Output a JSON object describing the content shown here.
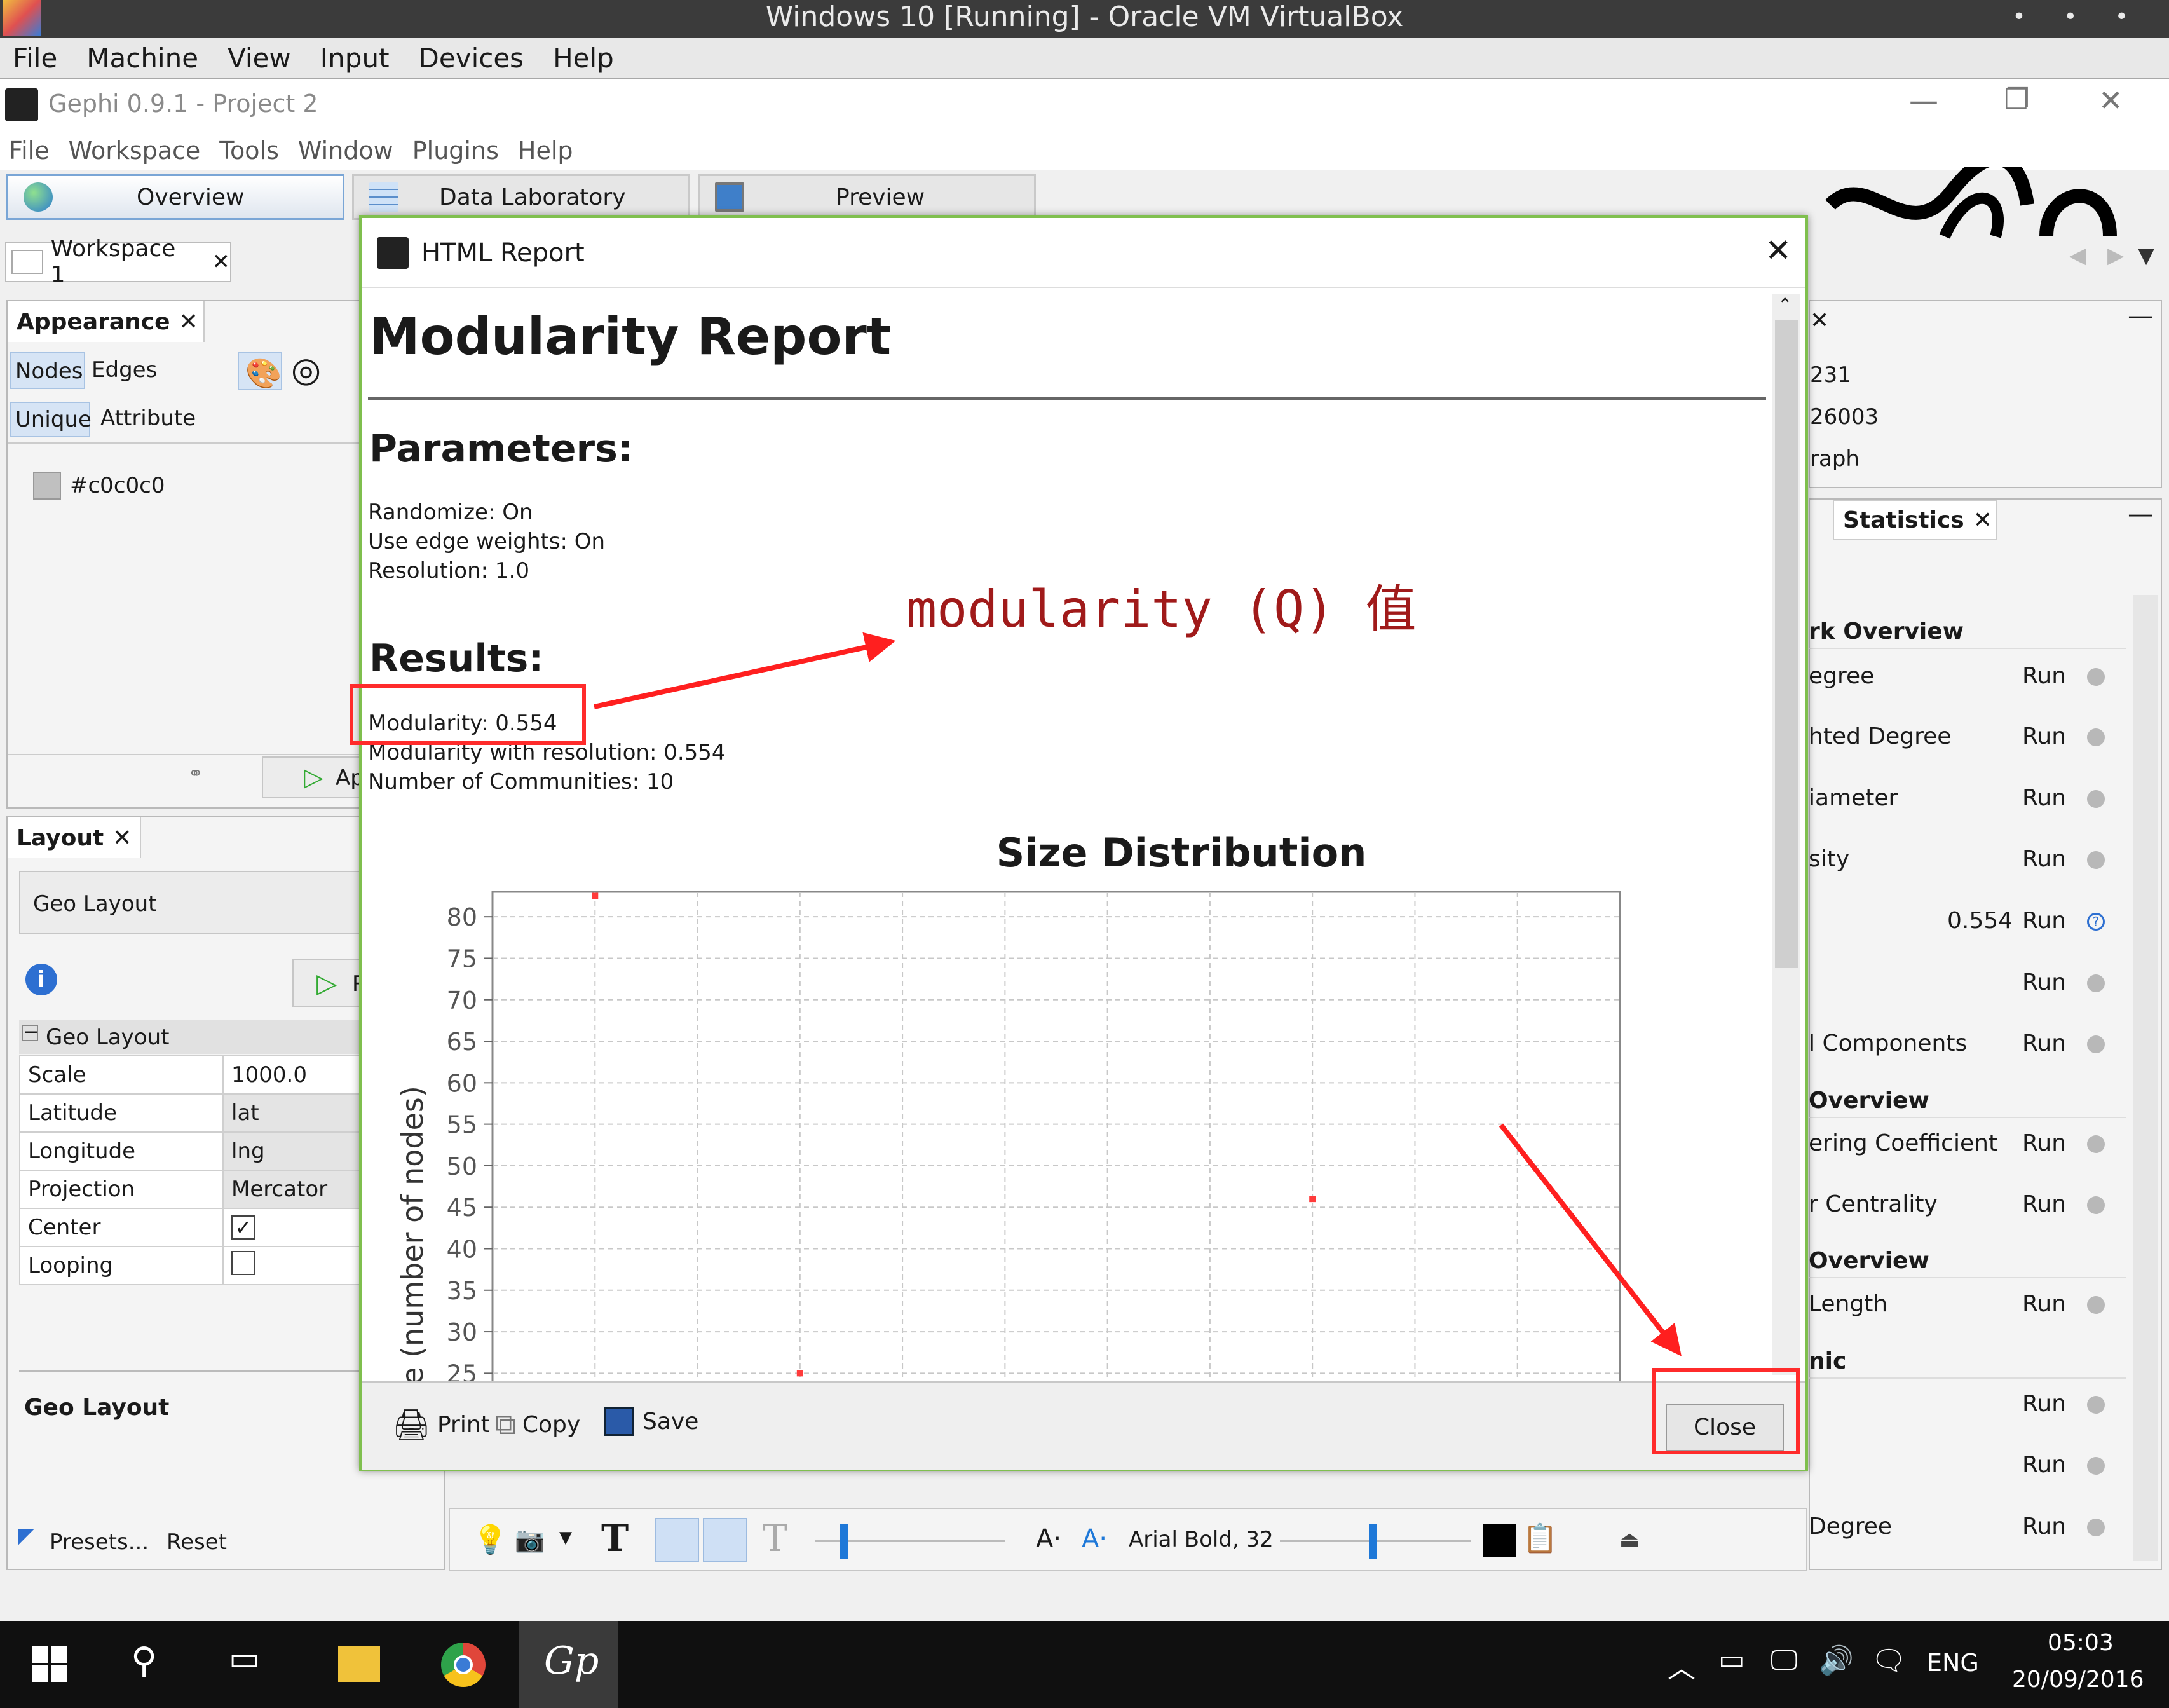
{
  "vbox": {
    "title": "Windows 10 [Running] - Oracle VM VirtualBox",
    "dots": "• • •",
    "menu": [
      "File",
      "Machine",
      "View",
      "Input",
      "Devices",
      "Help"
    ]
  },
  "gephi": {
    "title": "Gephi 0.9.1 - Project 2",
    "menu": [
      "File",
      "Workspace",
      "Tools",
      "Window",
      "Plugins",
      "Help"
    ],
    "win_ctrl": {
      "min": "—",
      "max": "❐",
      "close": "✕"
    },
    "tabs": [
      "Overview",
      "Data Laboratory",
      "Preview"
    ],
    "workspace_tab": "Workspace 1"
  },
  "appearance": {
    "title": "Appearance",
    "nodes": "Nodes",
    "edges": "Edges",
    "unique": "Unique",
    "attribute": "Attribute",
    "color_label": "#c0c0c0",
    "apply_partial": "Ap"
  },
  "layout": {
    "title": "Layout",
    "selected": "Geo Layout",
    "run_partial": "R",
    "group": "Geo Layout",
    "props": [
      {
        "name": "Scale",
        "value": "1000.0"
      },
      {
        "name": "Latitude",
        "value": "lat"
      },
      {
        "name": "Longitude",
        "value": "lng"
      },
      {
        "name": "Projection",
        "value": "Mercator"
      },
      {
        "name": "Center",
        "value": ""
      },
      {
        "name": "Looping",
        "value": ""
      }
    ],
    "desc_title": "Geo Layout",
    "presets": "Presets...",
    "reset": "Reset"
  },
  "dialog": {
    "title": "HTML Report",
    "close_x": "✕",
    "h1": "Modularity Report",
    "params_title": "Parameters:",
    "params": [
      "Randomize: On",
      "Use edge weights: On",
      "Resolution: 1.0"
    ],
    "results_title": "Results:",
    "results": [
      "Modularity: 0.554",
      "Modularity with resolution: 0.554",
      "Number of Communities: 10"
    ],
    "chart_title": "Size Distribution",
    "ylabel_partial": "ze (number of nodes)",
    "print": "Print",
    "copy": "Copy",
    "save": "Save",
    "close": "Close"
  },
  "annotation": {
    "text": "modularity (Q) 值"
  },
  "chart_data": {
    "type": "scatter",
    "title": "Size Distribution",
    "ylabel": "ze (number of nodes)",
    "yticks": [
      25,
      30,
      35,
      40,
      45,
      50,
      55,
      60,
      65,
      70,
      75,
      80
    ],
    "ylim": [
      22.5,
      83
    ],
    "points": [
      {
        "col": 1,
        "y": 82.5
      },
      {
        "col": 3,
        "y": 25
      },
      {
        "col": 8,
        "y": 46
      }
    ]
  },
  "context": {
    "values": [
      "231",
      "26003",
      "raph"
    ]
  },
  "statistics": {
    "title": "Statistics",
    "sections": [
      {
        "label": "rk Overview",
        "y": 993
      },
      {
        "label": "Overview",
        "y": 1731
      },
      {
        "label": "Overview",
        "y": 1983
      },
      {
        "label": "nic",
        "y": 2141
      }
    ],
    "rows": [
      {
        "label": "egree",
        "value": "",
        "y": 1065
      },
      {
        "label": "hted Degree",
        "value": "",
        "y": 1160
      },
      {
        "label": "iameter",
        "value": "",
        "y": 1257
      },
      {
        "label": "sity",
        "value": "",
        "y": 1353
      },
      {
        "label": "",
        "value": "0.554",
        "y": 1450
      },
      {
        "label": "",
        "value": "",
        "y": 1547
      },
      {
        "label": "l Components",
        "value": "",
        "y": 1643
      },
      {
        "label": "ering Coefficient",
        "value": "",
        "y": 1800
      },
      {
        "label": "r Centrality",
        "value": "",
        "y": 1896
      },
      {
        "label": "Length",
        "value": "",
        "y": 2053
      },
      {
        "label": "",
        "value": "",
        "y": 2210
      },
      {
        "label": "",
        "value": "",
        "y": 2306
      },
      {
        "label": "Degree",
        "value": "",
        "y": 2403
      }
    ],
    "run_label": "Run"
  },
  "bottom_toolbar": {
    "font": "Arial Bold, 32"
  },
  "taskbar": {
    "lang": "ENG",
    "time": "05:03",
    "date": "20/09/2016"
  }
}
